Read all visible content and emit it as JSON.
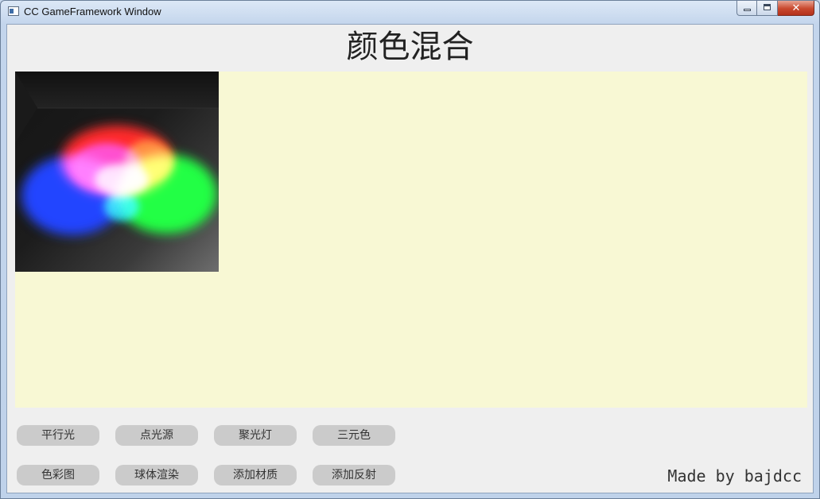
{
  "window": {
    "title": "CC GameFramework Window",
    "close_glyph": "✕"
  },
  "page": {
    "heading": "颜色混合",
    "credit": "Made by bajdcc"
  },
  "buttons": {
    "row1": [
      "平行光",
      "点光源",
      "聚光灯",
      "三元色"
    ],
    "row2": [
      "色彩图",
      "球体渲染",
      "添加材质",
      "添加反射"
    ]
  },
  "colors": {
    "canvas_background": "#f8f8d4",
    "client_background": "#efefef",
    "button_background": "#cbcbcb",
    "light_red": "#ff2a2a",
    "light_green": "#22ff44",
    "light_blue": "#2244ff"
  }
}
